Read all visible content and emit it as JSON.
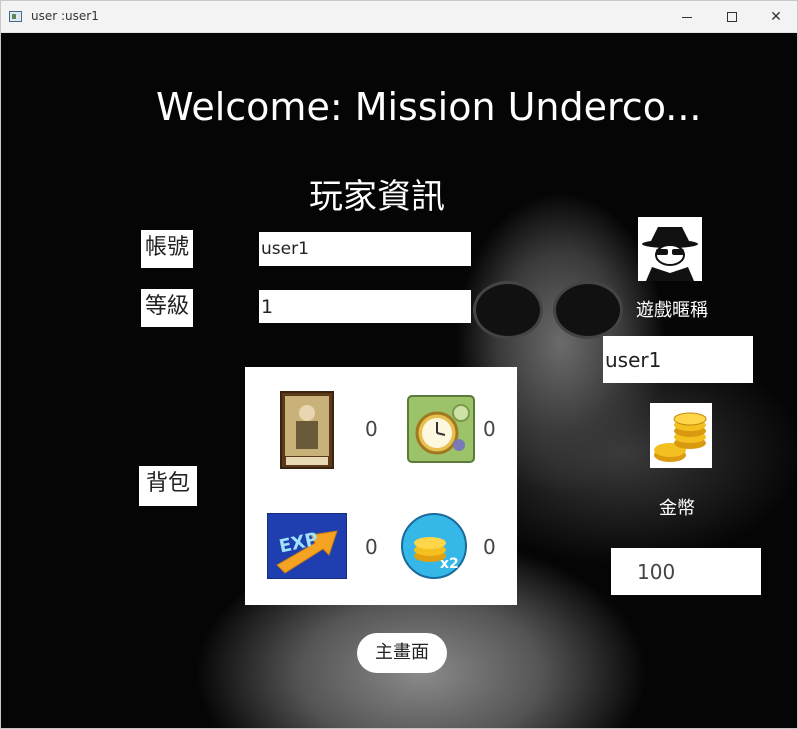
{
  "window": {
    "title": "user :user1",
    "controls": [
      "minimize",
      "maximize",
      "close"
    ]
  },
  "header": {
    "welcome_text": "Welcome: Mission Underco...",
    "section_title": "玩家資訊"
  },
  "account": {
    "label": "帳號",
    "value": "user1"
  },
  "level": {
    "label": "等級",
    "value": "1"
  },
  "backpack": {
    "label": "背包",
    "items": [
      {
        "icon": "agent-card-icon",
        "count": "0"
      },
      {
        "icon": "stopwatch-icon",
        "count": "0"
      },
      {
        "icon": "exp-boost-icon",
        "count": "0"
      },
      {
        "icon": "coin-double-icon",
        "count": "0"
      }
    ]
  },
  "profile": {
    "avatar_icon": "spy-avatar-icon",
    "nickname_label": "遊戲暱稱",
    "nickname_value": "user1"
  },
  "coins": {
    "icon": "gold-coins-icon",
    "label": "金幣",
    "value": "100"
  },
  "actions": {
    "home_label": "主畫面"
  },
  "colors": {
    "background": "#000000",
    "text_light": "#ffffff",
    "panel": "#ffffff"
  }
}
